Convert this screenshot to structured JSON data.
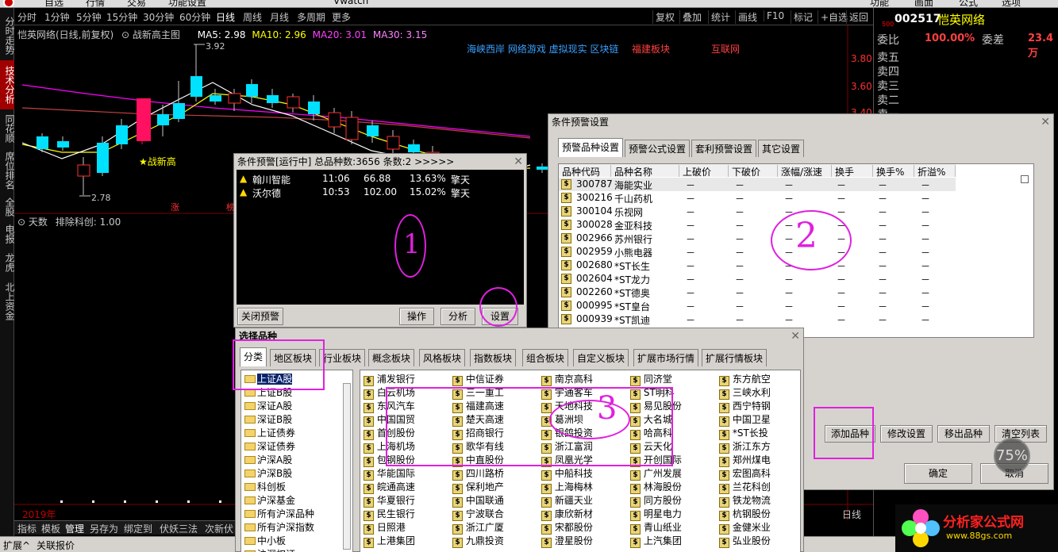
{
  "top_menu": [
    "自选",
    "行情",
    "交易",
    "功能设置",
    "Vwatch",
    "功能",
    "画面",
    "公式",
    "选项"
  ],
  "left_tabs": [
    "分时走势",
    "技术分析",
    "同花顺",
    "席位排名",
    "全股",
    "电报",
    "龙虎",
    "北上资金"
  ],
  "periods": [
    "分时",
    "1分钟",
    "5分钟",
    "15分钟",
    "30分钟",
    "60分钟",
    "日线",
    "周线",
    "月线",
    "多周期",
    "更多"
  ],
  "active_period": "日线",
  "right_buttons": [
    "复权",
    "叠加",
    "统计",
    "画线",
    "F10",
    "标记",
    "+自选",
    "返回"
  ],
  "chart": {
    "title": "恺英网络(日线,前复权)",
    "template": "战新高主图",
    "ma5": "MA5: 2.98",
    "ma10": "MA10: 2.96",
    "ma20": "MA20: 3.01",
    "ma30": "MA30: 3.15",
    "topics": [
      "海峡西岸 网络游戏 虚拟现实 区块链",
      "福建板块",
      "互联网"
    ],
    "high_label": "3.92",
    "low_label": "2.78",
    "signal_label": "★战新高",
    "price_ticks": [
      "3.80",
      "3.60",
      "3.40"
    ],
    "zhang_marks": [
      "涨",
      "榜"
    ],
    "year": "2019年"
  },
  "indicator": {
    "name": "天数",
    "detail": "排除科创: 1.00"
  },
  "bottom_tabs": [
    "指标",
    "模板",
    "管理",
    "另存为",
    "绑定到",
    "伏妖三法",
    "次新伏妖"
  ],
  "active_bottom_tab": "管理",
  "status": [
    "扩展^",
    "关联报价"
  ],
  "right_panel": {
    "code": "002517",
    "name": "恺英网络",
    "tag": "500",
    "weibi_label": "委比",
    "weibi": "100.00%",
    "weicha_label": "委差",
    "weicha": "23.4万",
    "sells": [
      "卖五",
      "卖四",
      "卖三",
      "卖二",
      "卖一"
    ],
    "bottom_labels": [
      "日线"
    ]
  },
  "dialog_alert": {
    "title": "条件预警[运行中] 总品种数:3656 条数:2 >>>>>",
    "rows": [
      {
        "name": "翰川智能",
        "time": "11:06",
        "price": "66.88",
        "pct": "13.63%",
        "cond": "擎天"
      },
      {
        "name": "沃尔德",
        "time": "10:53",
        "price": "102.00",
        "pct": "15.02%",
        "cond": "擎天"
      }
    ],
    "buttons": {
      "close": "关闭预警",
      "op": "操作",
      "analyze": "分析",
      "settings": "设置"
    },
    "annotation": "1"
  },
  "dialog_settings": {
    "title": "条件预警设置",
    "tabs": [
      "预警品种设置",
      "预警公式设置",
      "套利预警设置",
      "其它设置"
    ],
    "columns": [
      "品种代码",
      "品种名称",
      "上破价",
      "下破价",
      "涨幅/涨速",
      "换手",
      "换手%",
      "折溢%"
    ],
    "rows": [
      {
        "code": "300787",
        "name": "海能实业"
      },
      {
        "code": "300216",
        "name": "千山药机"
      },
      {
        "code": "300104",
        "name": "乐视网"
      },
      {
        "code": "300028",
        "name": "金亚科技"
      },
      {
        "code": "002966",
        "name": "苏州银行"
      },
      {
        "code": "002959",
        "name": "小熊电器"
      },
      {
        "code": "002680",
        "name": "*ST长生"
      },
      {
        "code": "002604",
        "name": "*ST龙力"
      },
      {
        "code": "002260",
        "name": "*ST德奥"
      },
      {
        "code": "000995",
        "name": "*ST皇台"
      },
      {
        "code": "000939",
        "name": "*ST凯迪"
      }
    ],
    "dash": "－",
    "buttons": {
      "add": "添加品种",
      "edit": "修改设置",
      "remove": "移出品种",
      "clear": "清空列表",
      "ok": "确定",
      "cancel": "取消"
    },
    "annotation": "2"
  },
  "dialog_select": {
    "title": "选择品种",
    "tabs": [
      "分类",
      "地区板块",
      "行业板块",
      "概念板块",
      "风格板块",
      "指数板块",
      "组合板块",
      "自定义板块",
      "扩展市场行情",
      "扩展行情板块"
    ],
    "tree": [
      "上证A股",
      "上证B股",
      "深证A股",
      "深证B股",
      "上证债券",
      "深证债券",
      "沪深A股",
      "沪深B股",
      "科创板",
      "沪深基金",
      "所有沪深品种",
      "所有沪深指数",
      "中小板",
      "沪深权证"
    ],
    "grid": [
      [
        "浦发银行",
        "中信证券",
        "南京高科",
        "同济堂",
        "东方航空"
      ],
      [
        "白云机场",
        "三一重工",
        "宇通客车",
        "ST明科",
        "三峡水利"
      ],
      [
        "东风汽车",
        "福建高速",
        "天地科技",
        "易见股份",
        "西宁特钢"
      ],
      [
        "中国国贸",
        "楚天高速",
        "葛洲坝",
        "大名城",
        "中国卫星"
      ],
      [
        "首创股份",
        "招商银行",
        "银鸽投资",
        "哈高科",
        "*ST长投"
      ],
      [
        "上海机场",
        "歌华有线",
        "浙江富润",
        "云天化",
        "浙江东方"
      ],
      [
        "包钢股份",
        "中直股份",
        "凤凰光学",
        "开创国际",
        "郑州煤电"
      ],
      [
        "华能国际",
        "四川路桥",
        "中船科技",
        "广州发展",
        "宏图高科"
      ],
      [
        "皖通高速",
        "保利地产",
        "上海梅林",
        "林海股份",
        "兰花科创"
      ],
      [
        "华夏银行",
        "中国联通",
        "新疆天业",
        "同方股份",
        "铁龙物流"
      ],
      [
        "民生银行",
        "宁波联合",
        "康欣新材",
        "明星电力",
        "杭钢股份"
      ],
      [
        "日照港",
        "浙江广厦",
        "宋都股份",
        "青山纸业",
        "金健米业"
      ],
      [
        "上港集团",
        "九鼎投资",
        "澄星股份",
        "上汽集团",
        "弘业股份"
      ]
    ],
    "annotation": "3"
  },
  "watermark": {
    "text": "分析家公式网",
    "url": "www.88gs.com"
  },
  "zoom": "75%",
  "colors": {
    "annotation": "#e020e0",
    "up": "#ff3030",
    "down": "#00e0ff",
    "ma20": "#ff00ff",
    "ma10": "#ffff00"
  }
}
